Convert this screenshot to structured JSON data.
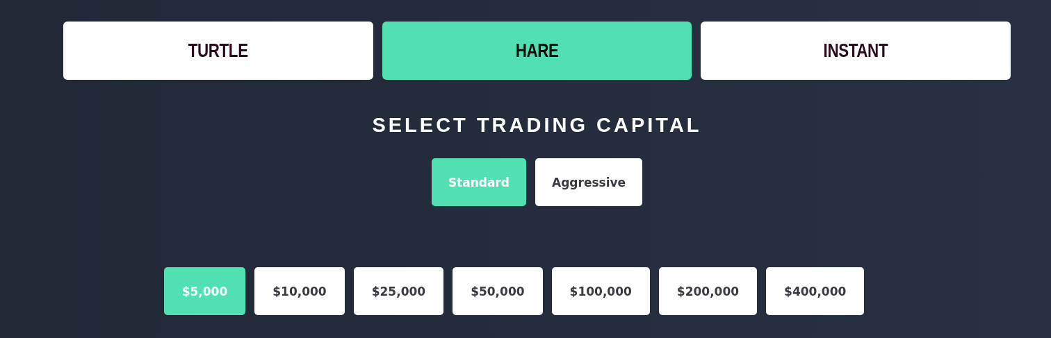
{
  "plans": [
    {
      "label": "TURTLE",
      "selected": false
    },
    {
      "label": "HARE",
      "selected": true
    },
    {
      "label": "INSTANT",
      "selected": false
    }
  ],
  "heading": "SELECT TRADING CAPITAL",
  "modes": [
    {
      "label": "Standard",
      "selected": true
    },
    {
      "label": "Aggressive",
      "selected": false
    }
  ],
  "amounts": [
    {
      "label": "$5,000",
      "selected": true
    },
    {
      "label": "$10,000",
      "selected": false
    },
    {
      "label": "$25,000",
      "selected": false
    },
    {
      "label": "$50,000",
      "selected": false
    },
    {
      "label": "$100,000",
      "selected": false
    },
    {
      "label": "$200,000",
      "selected": false
    },
    {
      "label": "$400,000",
      "selected": false
    }
  ]
}
